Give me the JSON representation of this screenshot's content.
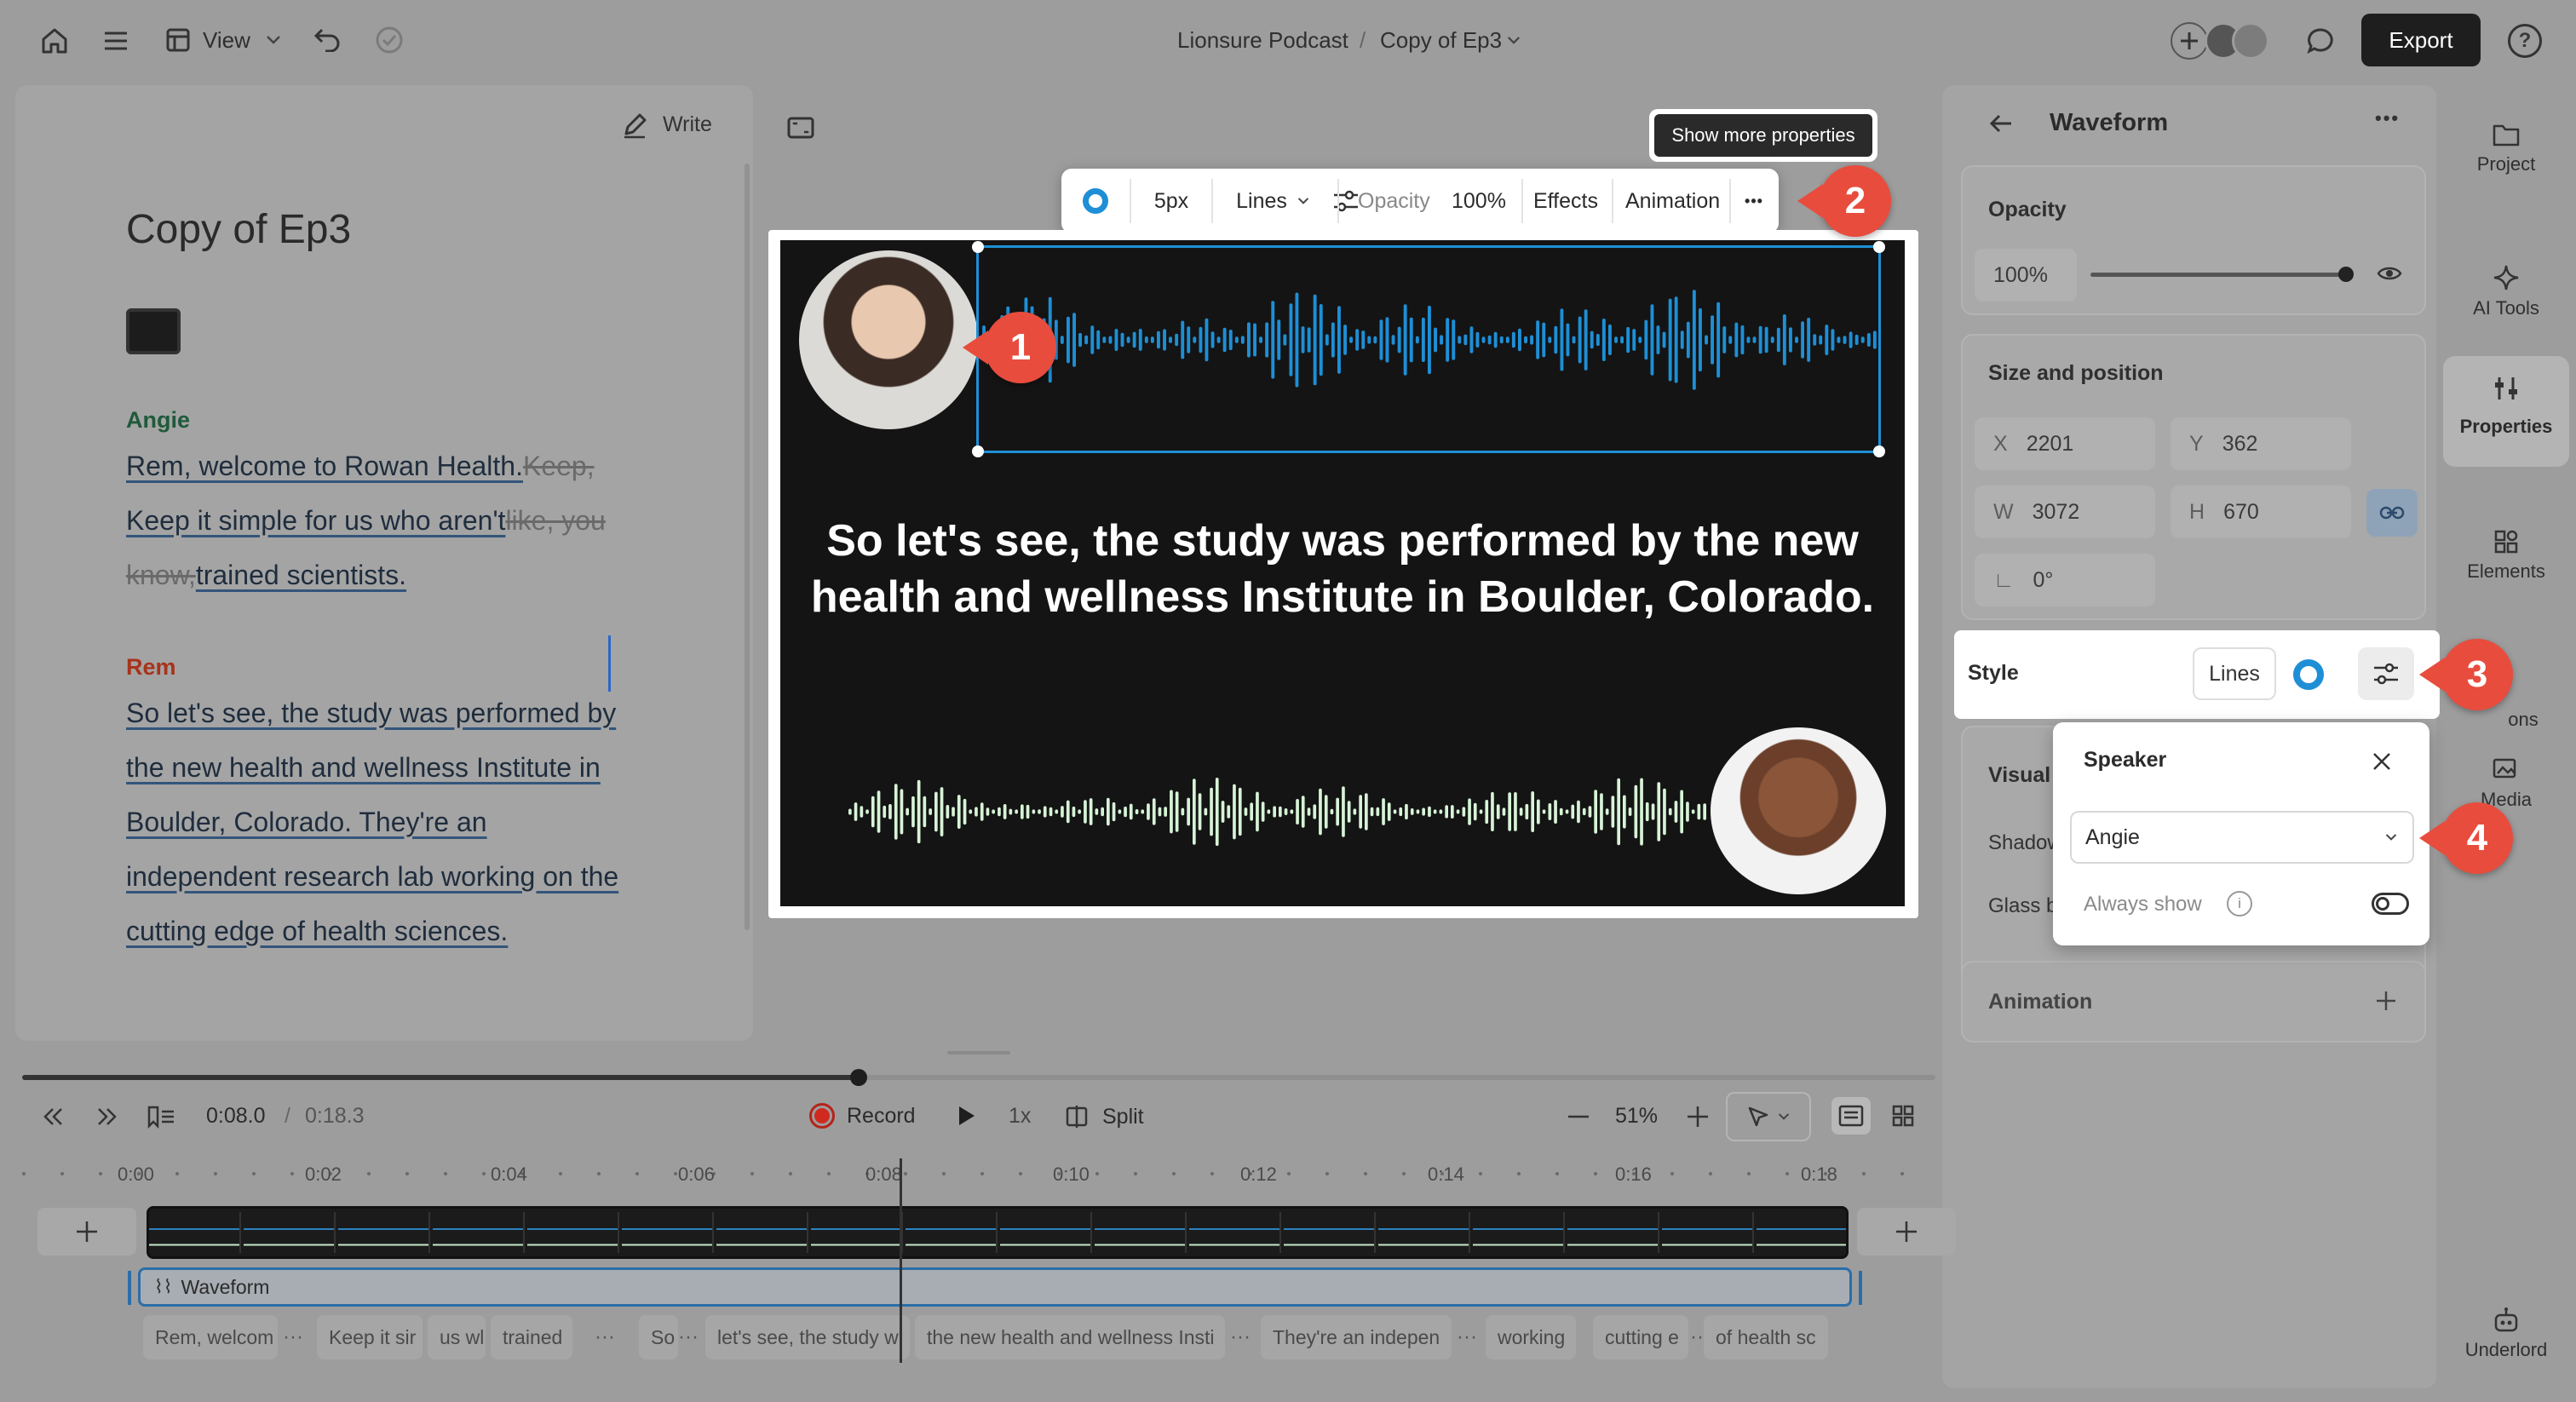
{
  "topbar": {
    "view_label": "View",
    "project_name": "Lionsure Podcast",
    "separator": "/",
    "doc_name": "Copy of Ep3",
    "export_label": "Export",
    "help_label": "?"
  },
  "script_panel": {
    "write_label": "Write",
    "title": "Copy of Ep3",
    "speakers": [
      {
        "name": "Angie",
        "color": "#1f5a3a"
      },
      {
        "name": "Rem",
        "color": "#a8331c"
      }
    ],
    "angie_lines": [
      {
        "text": "Rem, welcome to Rowan Health.",
        "strike": "Keep,"
      },
      {
        "text": "Keep it simple for us who aren't",
        "strike": "like, you"
      },
      {
        "text": "trained scientists.",
        "strike": "know,"
      }
    ],
    "rem_lines": [
      "So let's see, the study was performed by",
      "the new health and wellness Institute in",
      "Boulder, Colorado. They're an",
      "independent research lab working on the",
      "cutting edge of health sciences."
    ]
  },
  "canvas_toolbar": {
    "tooltip": "Show more properties",
    "stroke": "5px",
    "style": "Lines",
    "opacity_label": "Opacity",
    "opacity_value": "100%",
    "effects": "Effects",
    "animation": "Animation",
    "more": "•••"
  },
  "canvas": {
    "caption_line1": "So let's see, the study was performed by the new",
    "caption_line2": "health and wellness Institute in Boulder, Colorado.",
    "top_wave_color": "#1e8fd6",
    "bottom_wave_color": "#d7f3d7",
    "background": "#141414"
  },
  "callouts": [
    "1",
    "2",
    "3",
    "4"
  ],
  "properties": {
    "header": "Waveform",
    "opacity_section": "Opacity",
    "opacity_value": "100%",
    "opacity_level": 1.0,
    "size_section": "Size and position",
    "x_label": "X",
    "x_value": "2201",
    "y_label": "Y",
    "y_value": "362",
    "w_label": "W",
    "w_value": "3072",
    "h_label": "H",
    "h_value": "670",
    "rotation": "0°",
    "style_label": "Style",
    "style_value": "Lines",
    "visual_label": "Visual",
    "shadow_label": "Shadow",
    "glass_label": "Glass b",
    "animation_label": "Animation"
  },
  "speaker_popup": {
    "title": "Speaker",
    "selected": "Angie",
    "always_show": "Always show"
  },
  "rail": {
    "project": "Project",
    "ai_tools": "AI Tools",
    "properties": "Properties",
    "elements": "Elements",
    "captions": "ons",
    "media": "Media",
    "underlord": "Underlord"
  },
  "transport": {
    "current_time": "0:08.0",
    "divider": "/",
    "total_time": "0:18.3",
    "record": "Record",
    "speed": "1x",
    "split": "Split",
    "zoom": "51%",
    "progress": 0.437
  },
  "timeline": {
    "ticks": [
      "0:00",
      "0:02",
      "0:04",
      "0:06",
      "0:08",
      "0:10",
      "0:12",
      "0:14",
      "0:16",
      "0:18"
    ],
    "track_number": "1",
    "waveform_track": "Waveform",
    "clips": [
      "Rem, welcom",
      "Keep it sir",
      "us wl",
      "trained",
      "So",
      "let's see, the study w",
      "the new health and wellness Insti",
      "They're an indepen",
      "working",
      "cutting e",
      "of health sc"
    ],
    "ellipsis": "···"
  }
}
